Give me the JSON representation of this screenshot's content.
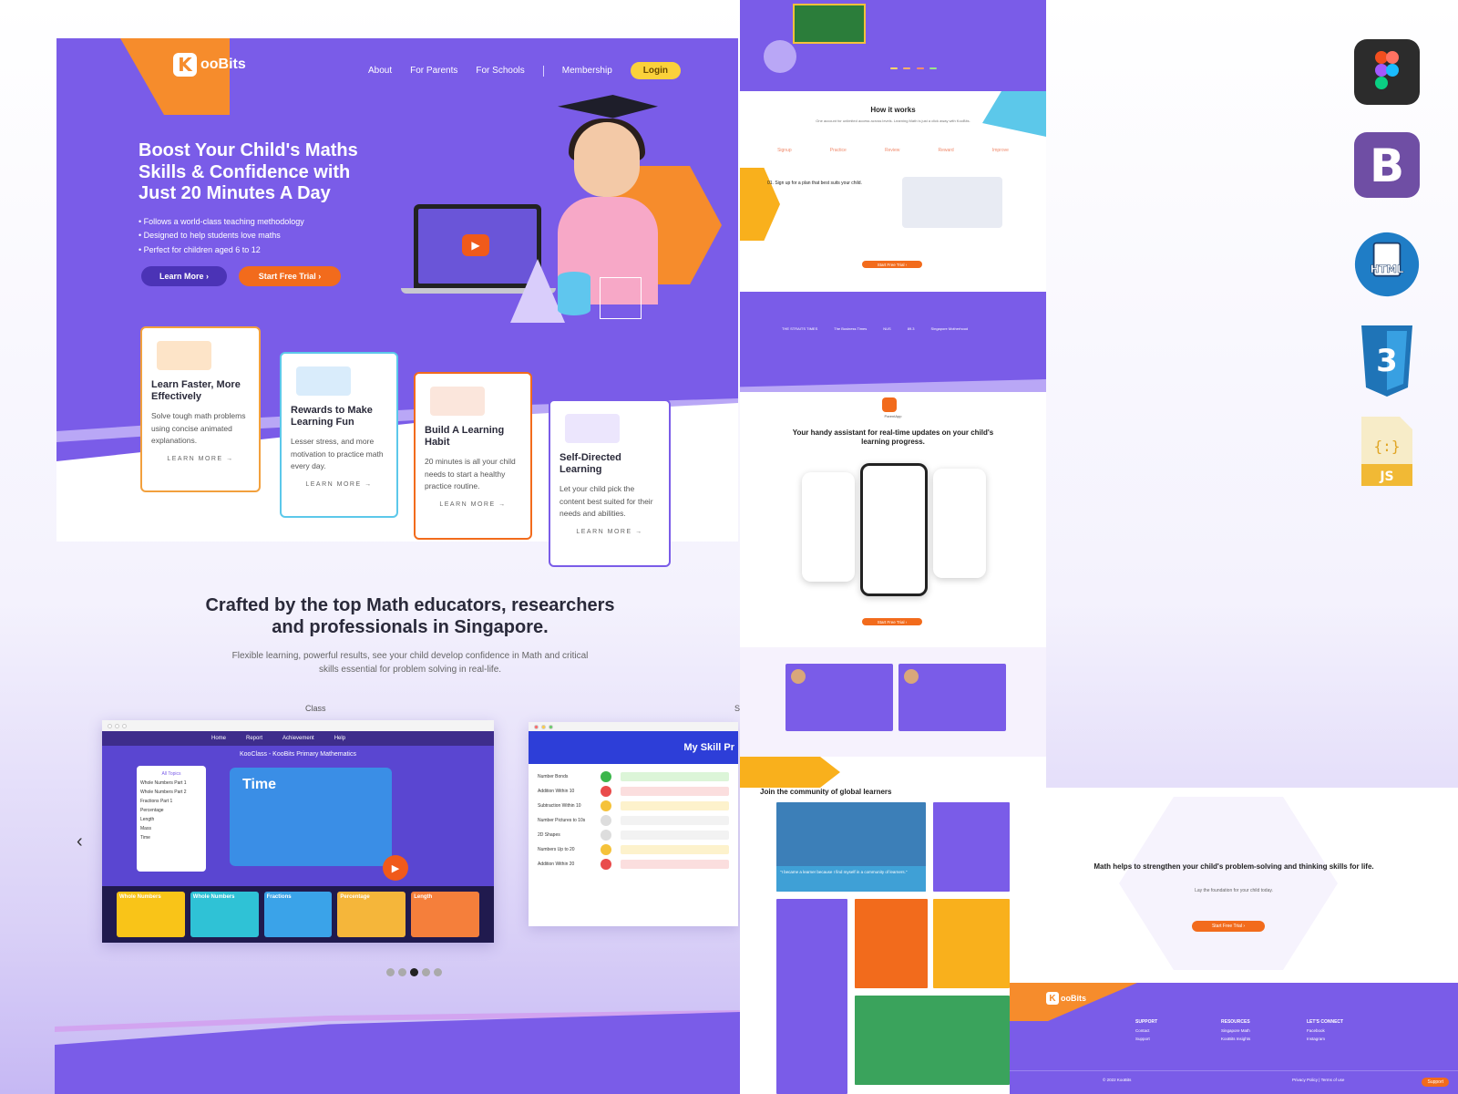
{
  "brand": {
    "logo_k": "K",
    "logo_text": "ooBits"
  },
  "nav": {
    "items": [
      "About",
      "For Parents",
      "For Schools",
      "Membership"
    ],
    "login": "Login"
  },
  "hero": {
    "title": "Boost Your Child's Maths Skills & Confidence with Just 20 Minutes A Day",
    "bullets": [
      "Follows a world-class teaching methodology",
      "Designed to help students love maths",
      "Perfect for children aged 6 to 12"
    ],
    "learn_more": "Learn More ›",
    "free_trial": "Start Free Trial ›"
  },
  "features": [
    {
      "title": "Learn Faster, More Effectively",
      "text": "Solve tough math problems using concise animated explanations.",
      "cta": "LEARN MORE  →",
      "color": "#f2a03d"
    },
    {
      "title": "Rewards to Make Learning Fun",
      "text": "Lesser stress, and more motivation to practice math every day.",
      "cta": "LEARN MORE  →",
      "color": "#5cc8ea"
    },
    {
      "title": "Build A Learning Habit",
      "text": "20 minutes is all your child needs to start a healthy practice routine.",
      "cta": "LEARN MORE  →",
      "color": "#f26b1c"
    },
    {
      "title": "Self-Directed Learning",
      "text": "Let your child pick the content best suited for their needs and abilities.",
      "cta": "LEARN MORE  →",
      "color": "#7a5ce8"
    }
  ],
  "crafted": {
    "title": "Crafted by the top Math educators, researchers and professionals in Singapore.",
    "subtitle": "Flexible learning, powerful results, see your child develop confidence in Math and critical skills essential for problem solving in real-life."
  },
  "carousel": {
    "label_class": "Class",
    "label_s": "S",
    "class_shot": {
      "nav": [
        "Home",
        "Report",
        "Achievement",
        "Help"
      ],
      "title": "KooClass - KooBits Primary Mathematics",
      "topics_header": "All Topics",
      "topics": [
        "Whole Numbers Part 1",
        "Whole Numbers Part 2",
        "Fractions Part 1",
        "Percentage",
        "Length",
        "Mass",
        "Time"
      ],
      "lesson": "Time",
      "tiles": [
        "Whole Numbers",
        "Whole Numbers",
        "Fractions",
        "Percentage",
        "Length"
      ]
    },
    "skill_shot": {
      "title": "My Skill Pr",
      "rows": [
        "Number Bonds",
        "Addition Within 10",
        "Subtraction Within 10",
        "Number Pictures to 10s",
        "2D Shapes",
        "Numbers Up to 20",
        "Addition Within 20"
      ]
    },
    "dots": 5,
    "active_dot": 2
  },
  "middle": {
    "how_title": "How it works",
    "how_sub": "One account for unlimited access across levels. Learning Math is just a click away with KooBits.",
    "steps": [
      "Signup",
      "Practice",
      "Review",
      "Reward",
      "Improve"
    ],
    "step1": "01. Sign up for a plan that best suits your child.",
    "free_trial": "Start Free Trial ›",
    "parent_app_title": "Your handy assistant for real-time updates on your child's learning progress.",
    "parent_app": "ParentApp",
    "press": [
      "THE STRAITS TIMES",
      "The Business Times",
      "NUS",
      "89.3",
      "Singapore Motherhood"
    ],
    "community_title": "Join the community of global learners",
    "quote1": "\"I became a learner because I find myself in a community of learners.\""
  },
  "right_panel": {
    "title": "Math helps to strengthen your child's problem-solving and thinking skills for life.",
    "sub": "Lay the foundation for your child today.",
    "cta": "Start Free Trial ›"
  },
  "footer": {
    "cols": [
      {
        "title": "SUPPORT",
        "items": [
          "Contact",
          "Support"
        ]
      },
      {
        "title": "RESOURCES",
        "items": [
          "Singapore Math",
          "KooBits Insights"
        ]
      },
      {
        "title": "LET'S CONNECT",
        "items": [
          "Facebook",
          "Instagram"
        ]
      }
    ],
    "copyright": "© 2022 KooBits",
    "links": "Privacy Policy  |  Terms of use",
    "support_btn": "Support"
  },
  "tools": [
    "figma-icon",
    "bootstrap-icon",
    "html-icon",
    "css3-icon",
    "js-icon"
  ]
}
